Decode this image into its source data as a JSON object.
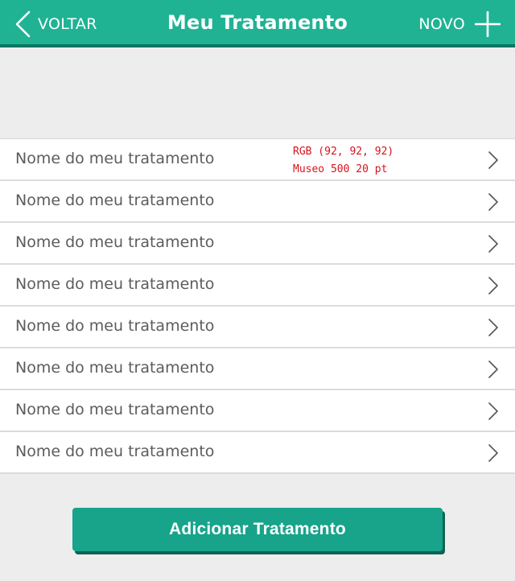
{
  "header": {
    "back_label": "VOLTAR",
    "title": "Meu Tratamento",
    "new_label": "NOVO"
  },
  "annotation": {
    "line1": "RGB (92, 92, 92)",
    "line2": "Museo 500 20 pt"
  },
  "treatments": [
    "Nome do meu tratamento",
    "Nome do meu tratamento",
    "Nome do meu tratamento",
    "Nome do meu tratamento",
    "Nome do meu tratamento",
    "Nome do meu tratamento",
    "Nome do meu tratamento",
    "Nome do meu tratamento"
  ],
  "add_button_label": "Adicionar Tratamento",
  "colors": {
    "header_bg": "#1fb394",
    "header_border": "#0e7562",
    "row_text": "#5c5c5c",
    "button_bg": "#17a48b",
    "annotation": "#d8121b"
  }
}
